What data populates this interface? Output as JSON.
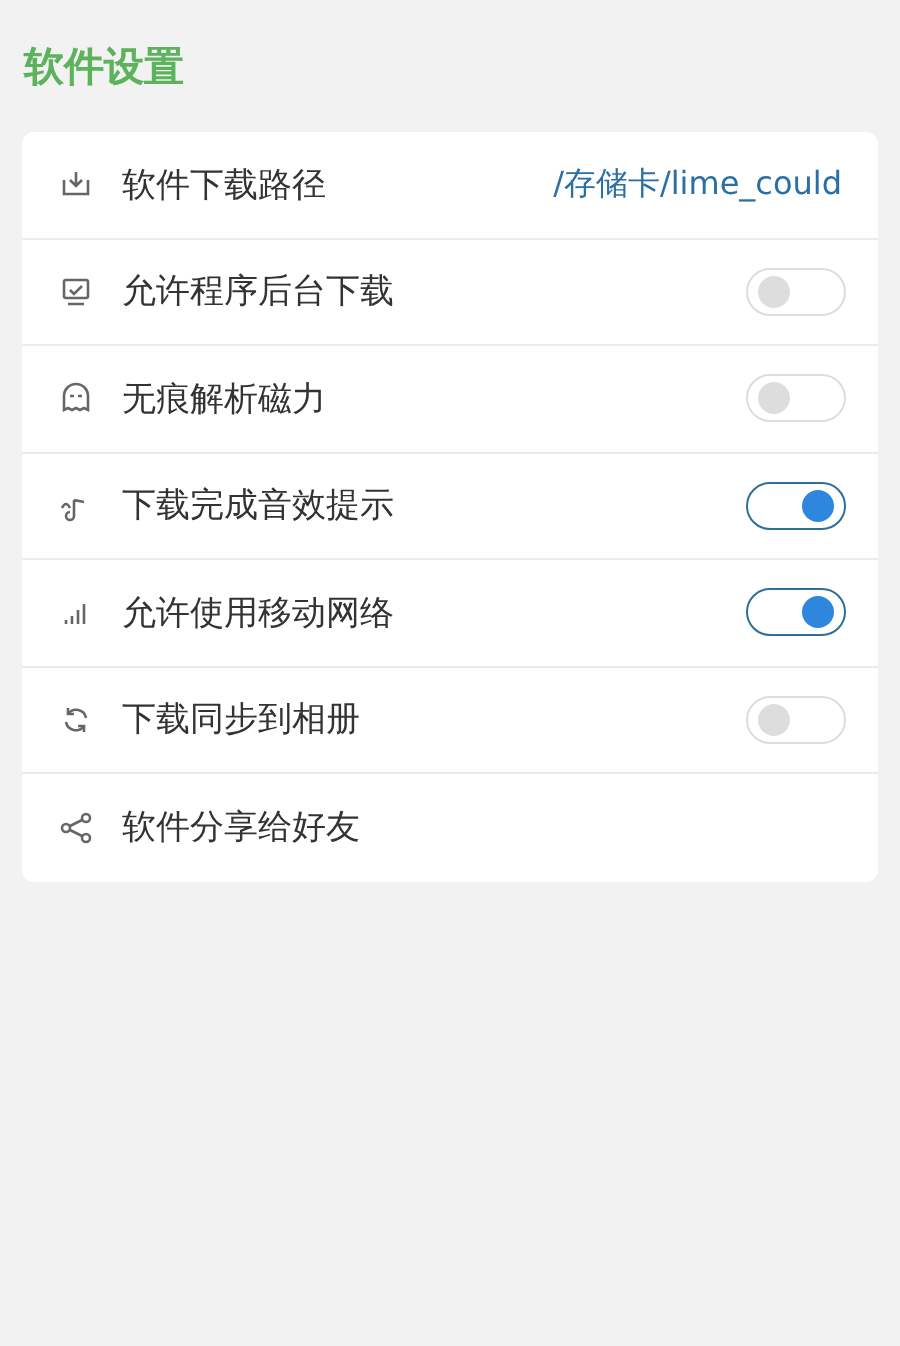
{
  "title": "软件设置",
  "items": [
    {
      "kind": "value",
      "label": "软件下载路径",
      "value": "/存储卡/lime_could"
    },
    {
      "kind": "switch",
      "label": "允许程序后台下载",
      "on": false
    },
    {
      "kind": "switch",
      "label": "无痕解析磁力",
      "on": false
    },
    {
      "kind": "switch",
      "label": "下载完成音效提示",
      "on": true
    },
    {
      "kind": "switch",
      "label": "允许使用移动网络",
      "on": true
    },
    {
      "kind": "switch",
      "label": "下载同步到相册",
      "on": false
    },
    {
      "kind": "plain",
      "label": "软件分享给好友"
    }
  ]
}
